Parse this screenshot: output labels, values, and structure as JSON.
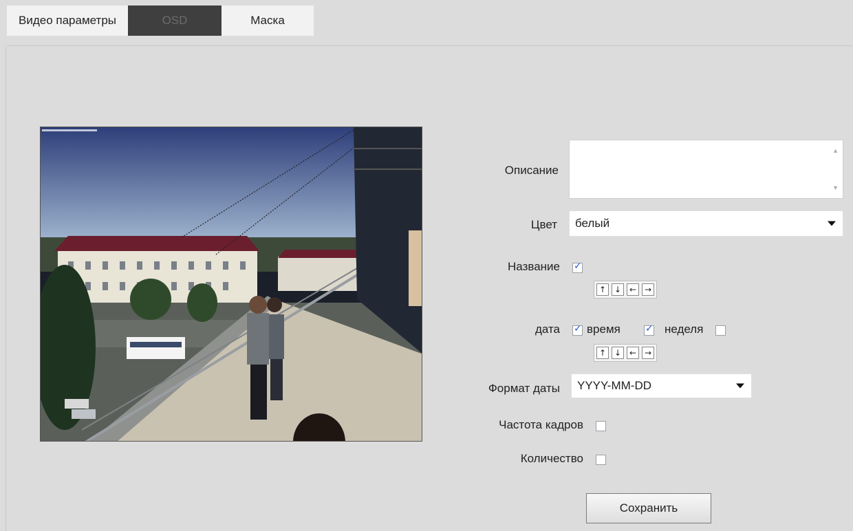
{
  "tabs": [
    {
      "label": "Видео параметры"
    },
    {
      "label": "OSD"
    },
    {
      "label": "Маска"
    }
  ],
  "form": {
    "description_label": "Описание",
    "description_value": "",
    "color_label": "Цвет",
    "color_value": "белый",
    "title_label": "Название",
    "title_checked": true,
    "date_label": "дата",
    "date_checked": true,
    "time_label": "время",
    "time_checked": true,
    "week_label": "неделя",
    "week_checked": false,
    "date_format_label": "Формат даты",
    "date_format_value": "YYYY-MM-DD",
    "framerate_label": "Частота кадров",
    "framerate_checked": false,
    "count_label": "Количество",
    "count_checked": false,
    "save_label": "Сохранить"
  },
  "position_arrows": [
    "↑",
    "↓",
    "←",
    "→"
  ],
  "icons": {
    "up": "arrow-up-icon",
    "down": "arrow-down-icon",
    "left": "arrow-left-icon",
    "right": "arrow-right-icon"
  }
}
